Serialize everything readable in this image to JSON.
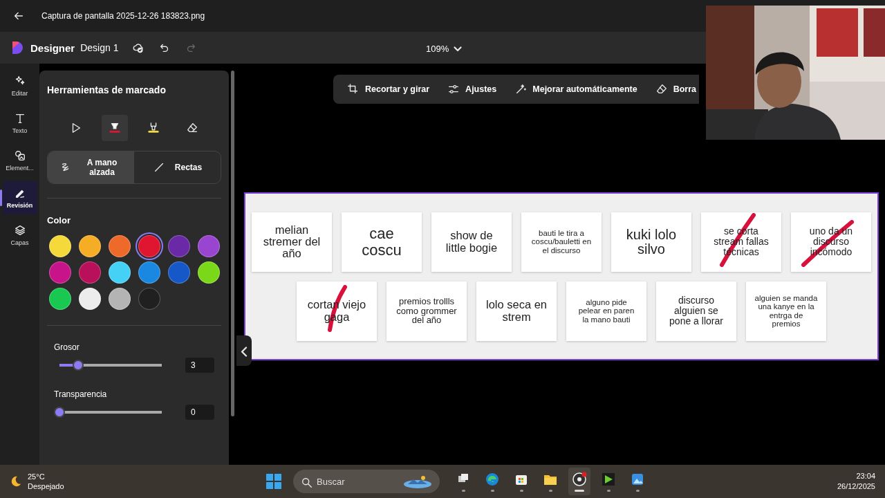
{
  "title_bar": {
    "title": "Captura de pantalla 2025-12-26 183823.png"
  },
  "app_bar": {
    "app_name": "Designer",
    "document": "Design 1",
    "zoom": "109%"
  },
  "rail": [
    {
      "label": "Editar",
      "kind": "edit",
      "selected": false
    },
    {
      "label": "Texto",
      "kind": "text",
      "selected": false
    },
    {
      "label": "Element...",
      "kind": "elements",
      "selected": false
    },
    {
      "label": "Revisión",
      "kind": "review",
      "selected": true
    },
    {
      "label": "Capas",
      "kind": "layers",
      "selected": false
    }
  ],
  "panel": {
    "title": "Herramientas de marcado",
    "tools": [
      {
        "kind": "pointer",
        "selected": false
      },
      {
        "kind": "pen",
        "selected": true
      },
      {
        "kind": "highlighter",
        "selected": false
      },
      {
        "kind": "eraser",
        "selected": false
      }
    ],
    "modes": [
      {
        "label": "A mano alzada",
        "kind": "freehand",
        "selected": true
      },
      {
        "label": "Rectas",
        "kind": "line",
        "selected": false
      }
    ],
    "color_label": "Color",
    "colors": [
      {
        "color": "#f5d83a",
        "selected": false
      },
      {
        "color": "#f5ad25",
        "selected": false
      },
      {
        "color": "#ee6a2a",
        "selected": false
      },
      {
        "color": "#e01530",
        "selected": true
      },
      {
        "color": "#6a2aa8",
        "selected": false
      },
      {
        "color": "#9a45d0",
        "selected": false
      },
      {
        "color": "#c8148a",
        "selected": false
      },
      {
        "color": "#b8105a",
        "selected": false
      },
      {
        "color": "#45d0f5",
        "selected": false
      },
      {
        "color": "#1a88e0",
        "selected": false
      },
      {
        "color": "#1658c8",
        "selected": false
      },
      {
        "color": "#7ad818",
        "selected": false
      },
      {
        "color": "#18c850",
        "selected": false
      },
      {
        "color": "#ececec",
        "selected": false
      },
      {
        "color": "#b4b4b4",
        "selected": false
      },
      {
        "color": "#202020",
        "selected": false
      }
    ],
    "sliders": [
      {
        "label": "Grosor",
        "level": 0.18,
        "value": "3"
      },
      {
        "label": "Transparencia",
        "level": 0,
        "value": "0"
      }
    ]
  },
  "toolbar": [
    {
      "label": "Recortar y girar",
      "kind": "crop"
    },
    {
      "label": "Ajustes",
      "kind": "adjust"
    },
    {
      "label": "Mejorar automáticamente",
      "kind": "magic"
    },
    {
      "label": "Borra",
      "kind": "eraser"
    }
  ],
  "cards": [
    [
      {
        "text": "melian stremer del año",
        "struck": false
      },
      {
        "text": "cae coscu",
        "struck": false
      },
      {
        "text": "show de little bogie",
        "struck": false
      },
      {
        "text": "bauti le tira a coscu/bauletti en el discurso",
        "struck": false
      },
      {
        "text": "kuki lolo silvo",
        "struck": false
      },
      {
        "text": "se corta stream fallas técnicas",
        "struck": true
      },
      {
        "text": "uno da un discurso incómodo",
        "struck": true
      }
    ],
    [
      {
        "text": "cortan viejo gaga",
        "struck": true
      },
      {
        "text": "premios trollls como grommer del año",
        "struck": false
      },
      {
        "text": "lolo seca en strem",
        "struck": false
      },
      {
        "text": "alguno pide pelear en paren la mano bauti",
        "struck": false
      },
      {
        "text": "discurso alguien se pone a llorar",
        "struck": false
      },
      {
        "text": "alguien se manda una kanye en la entrga de premios",
        "struck": false
      }
    ]
  ],
  "webcam": {
    "kind": "picture"
  },
  "taskbar": {
    "temperature": "25°C",
    "weather": "Despejado",
    "search_placeholder": "Buscar",
    "apps": [
      {
        "kind": "taskview",
        "selected": false
      },
      {
        "kind": "browser",
        "selected": false
      },
      {
        "kind": "store",
        "selected": false
      },
      {
        "kind": "folder",
        "selected": false
      },
      {
        "kind": "recorder",
        "selected": true
      },
      {
        "kind": "player",
        "selected": false
      },
      {
        "kind": "photos",
        "selected": false
      }
    ],
    "time": "23:04",
    "date": "26/12/2025"
  }
}
